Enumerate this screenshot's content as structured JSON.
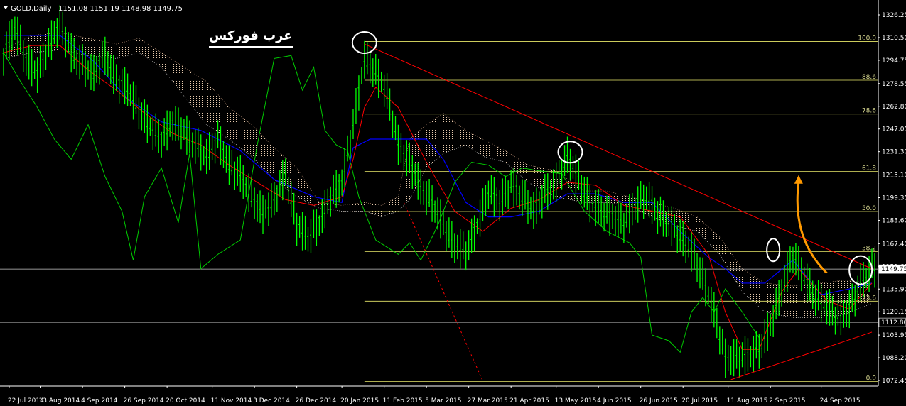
{
  "header": {
    "menu_glyph": "▼",
    "symbol": "GOLD,Daily",
    "ohlc": "1151.08 1151.19 1148.98 1149.75"
  },
  "logo_text": "عرب فوركس",
  "colors": {
    "background": "#000000",
    "price": "#00ff00",
    "kijun": "#0000ff",
    "tenkan": "#ff0000",
    "chikou": "#00cc00",
    "cloud_bull": "#ffe0c0",
    "cloud_bear": "#ffffff",
    "fib": "#e8e86a",
    "trend": "#ff0000",
    "arrow": "#ff9900",
    "circle": "#ffffff",
    "hline": "#c8c8c8"
  },
  "chart_data": {
    "type": "line",
    "symbol": "GOLD",
    "timeframe": "Daily",
    "y_ticks": [
      "1326.25",
      "1310.50",
      "1294.75",
      "1278.55",
      "1262.80",
      "1247.05",
      "1231.30",
      "1215.10",
      "1199.35",
      "1183.60",
      "1167.40",
      "1151.65",
      "1135.90",
      "1120.15",
      "1103.95",
      "1088.20",
      "1072.45"
    ],
    "x_ticks": [
      "22 Jul 2014",
      "13 Aug 2014",
      "4 Sep 2014",
      "26 Sep 2014",
      "20 Oct 2014",
      "11 Nov 2014",
      "3 Dec 2014",
      "26 Dec 2014",
      "20 Jan 2015",
      "11 Feb 2015",
      "5 Mar 2015",
      "27 Mar 2015",
      "21 Apr 2015",
      "13 May 2015",
      "4 Jun 2015",
      "26 Jun 2015",
      "20 Jul 2015",
      "11 Aug 2015",
      "2 Sep 2015",
      "24 Sep 2015"
    ],
    "ylim": [
      1072.45,
      1326.25
    ],
    "current_price_label": "1149.75",
    "horizontal_line_label": "1112.80",
    "current_price": 1149.75,
    "horizontal_line": 1112.8,
    "fibonacci": {
      "levels": [
        {
          "label": "100.0",
          "price": 1307.8
        },
        {
          "label": "88.6",
          "price": 1280.9
        },
        {
          "label": "78.6",
          "price": 1257.4
        },
        {
          "label": "61.8",
          "price": 1217.6
        },
        {
          "label": "50.0",
          "price": 1189.7
        },
        {
          "label": "38.2",
          "price": 1161.9
        },
        {
          "label": "23.6",
          "price": 1127.5
        },
        {
          "label": "0.0",
          "price": 1071.7
        }
      ],
      "start_date_index": 128
    },
    "price_series": [
      [
        0,
        1298
      ],
      [
        4,
        1318
      ],
      [
        8,
        1294
      ],
      [
        12,
        1286
      ],
      [
        16,
        1305
      ],
      [
        20,
        1320
      ],
      [
        24,
        1300
      ],
      [
        28,
        1292
      ],
      [
        32,
        1285
      ],
      [
        36,
        1298
      ],
      [
        40,
        1280
      ],
      [
        44,
        1275
      ],
      [
        48,
        1260
      ],
      [
        52,
        1248
      ],
      [
        56,
        1240
      ],
      [
        60,
        1252
      ],
      [
        64,
        1245
      ],
      [
        68,
        1236
      ],
      [
        72,
        1228
      ],
      [
        76,
        1240
      ],
      [
        80,
        1222
      ],
      [
        84,
        1215
      ],
      [
        88,
        1200
      ],
      [
        92,
        1188
      ],
      [
        96,
        1198
      ],
      [
        100,
        1216
      ],
      [
        104,
        1180
      ],
      [
        108,
        1172
      ],
      [
        112,
        1182
      ],
      [
        116,
        1200
      ],
      [
        120,
        1210
      ],
      [
        124,
        1250
      ],
      [
        128,
        1296
      ],
      [
        132,
        1286
      ],
      [
        136,
        1272
      ],
      [
        140,
        1236
      ],
      [
        144,
        1224
      ],
      [
        148,
        1206
      ],
      [
        152,
        1196
      ],
      [
        156,
        1180
      ],
      [
        160,
        1166
      ],
      [
        164,
        1162
      ],
      [
        168,
        1180
      ],
      [
        172,
        1204
      ],
      [
        176,
        1196
      ],
      [
        180,
        1208
      ],
      [
        184,
        1200
      ],
      [
        188,
        1190
      ],
      [
        192,
        1202
      ],
      [
        196,
        1210
      ],
      [
        200,
        1228
      ],
      [
        204,
        1212
      ],
      [
        208,
        1196
      ],
      [
        212,
        1190
      ],
      [
        216,
        1186
      ],
      [
        220,
        1182
      ],
      [
        224,
        1194
      ],
      [
        228,
        1200
      ],
      [
        232,
        1188
      ],
      [
        236,
        1182
      ],
      [
        240,
        1172
      ],
      [
        244,
        1162
      ],
      [
        248,
        1144
      ],
      [
        252,
        1120
      ],
      [
        256,
        1088
      ],
      [
        260,
        1088
      ],
      [
        264,
        1090
      ],
      [
        268,
        1094
      ],
      [
        272,
        1110
      ],
      [
        276,
        1136
      ],
      [
        280,
        1160
      ],
      [
        284,
        1144
      ],
      [
        288,
        1130
      ],
      [
        292,
        1124
      ],
      [
        296,
        1116
      ],
      [
        300,
        1122
      ],
      [
        304,
        1140
      ],
      [
        308,
        1150
      ]
    ],
    "tenkan_series": [
      [
        0,
        1300
      ],
      [
        10,
        1305
      ],
      [
        20,
        1305
      ],
      [
        30,
        1288
      ],
      [
        40,
        1274
      ],
      [
        50,
        1258
      ],
      [
        60,
        1244
      ],
      [
        70,
        1236
      ],
      [
        80,
        1222
      ],
      [
        90,
        1210
      ],
      [
        100,
        1198
      ],
      [
        110,
        1194
      ],
      [
        120,
        1200
      ],
      [
        124,
        1226
      ],
      [
        128,
        1262
      ],
      [
        132,
        1276
      ],
      [
        140,
        1262
      ],
      [
        150,
        1224
      ],
      [
        160,
        1190
      ],
      [
        170,
        1176
      ],
      [
        180,
        1192
      ],
      [
        190,
        1198
      ],
      [
        200,
        1210
      ],
      [
        210,
        1208
      ],
      [
        220,
        1194
      ],
      [
        230,
        1190
      ],
      [
        240,
        1186
      ],
      [
        250,
        1160
      ],
      [
        256,
        1120
      ],
      [
        262,
        1094
      ],
      [
        268,
        1094
      ],
      [
        276,
        1134
      ],
      [
        282,
        1150
      ],
      [
        292,
        1128
      ],
      [
        300,
        1122
      ],
      [
        308,
        1140
      ]
    ],
    "kijun_series": [
      [
        0,
        1312
      ],
      [
        20,
        1312
      ],
      [
        32,
        1294
      ],
      [
        44,
        1268
      ],
      [
        56,
        1252
      ],
      [
        70,
        1246
      ],
      [
        84,
        1232
      ],
      [
        96,
        1212
      ],
      [
        110,
        1200
      ],
      [
        120,
        1196
      ],
      [
        124,
        1234
      ],
      [
        130,
        1240
      ],
      [
        140,
        1240
      ],
      [
        150,
        1240
      ],
      [
        156,
        1226
      ],
      [
        164,
        1196
      ],
      [
        172,
        1186
      ],
      [
        180,
        1186
      ],
      [
        190,
        1190
      ],
      [
        200,
        1202
      ],
      [
        210,
        1202
      ],
      [
        220,
        1196
      ],
      [
        230,
        1196
      ],
      [
        240,
        1176
      ],
      [
        250,
        1158
      ],
      [
        256,
        1150
      ],
      [
        262,
        1140
      ],
      [
        270,
        1140
      ],
      [
        280,
        1156
      ],
      [
        290,
        1132
      ],
      [
        300,
        1136
      ],
      [
        308,
        1140
      ]
    ],
    "chikou_series": [
      [
        0,
        1300
      ],
      [
        6,
        1280
      ],
      [
        12,
        1262
      ],
      [
        18,
        1240
      ],
      [
        24,
        1226
      ],
      [
        30,
        1250
      ],
      [
        36,
        1214
      ],
      [
        42,
        1190
      ],
      [
        46,
        1156
      ],
      [
        50,
        1200
      ],
      [
        56,
        1220
      ],
      [
        62,
        1182
      ],
      [
        66,
        1230
      ],
      [
        70,
        1150
      ],
      [
        76,
        1160
      ],
      [
        84,
        1170
      ],
      [
        90,
        1236
      ],
      [
        96,
        1296
      ],
      [
        102,
        1298
      ],
      [
        106,
        1274
      ],
      [
        110,
        1290
      ],
      [
        114,
        1246
      ],
      [
        118,
        1236
      ],
      [
        122,
        1232
      ],
      [
        126,
        1200
      ],
      [
        132,
        1170
      ],
      [
        136,
        1165
      ],
      [
        140,
        1160
      ],
      [
        144,
        1168
      ],
      [
        148,
        1156
      ],
      [
        154,
        1180
      ],
      [
        160,
        1210
      ],
      [
        166,
        1224
      ],
      [
        172,
        1222
      ],
      [
        178,
        1214
      ],
      [
        184,
        1220
      ],
      [
        190,
        1218
      ],
      [
        198,
        1216
      ],
      [
        206,
        1190
      ],
      [
        214,
        1176
      ],
      [
        222,
        1168
      ],
      [
        226,
        1158
      ],
      [
        230,
        1104
      ],
      [
        236,
        1100
      ],
      [
        240,
        1092
      ],
      [
        244,
        1120
      ],
      [
        248,
        1130
      ],
      [
        252,
        1120
      ],
      [
        256,
        1136
      ],
      [
        262,
        1120
      ],
      [
        268,
        1102
      ]
    ],
    "cloud": [
      [
        0,
        1296,
        1302
      ],
      [
        10,
        1300,
        1312
      ],
      [
        20,
        1302,
        1314
      ],
      [
        30,
        1298,
        1310
      ],
      [
        40,
        1296,
        1306
      ],
      [
        48,
        1300,
        1310
      ],
      [
        56,
        1290,
        1300
      ],
      [
        64,
        1270,
        1290
      ],
      [
        72,
        1250,
        1280
      ],
      [
        80,
        1240,
        1262
      ],
      [
        88,
        1228,
        1250
      ],
      [
        96,
        1212,
        1234
      ],
      [
        104,
        1200,
        1220
      ],
      [
        112,
        1192,
        1196
      ],
      [
        120,
        1190,
        1194
      ],
      [
        128,
        1190,
        1196
      ],
      [
        134,
        1186,
        1194
      ],
      [
        140,
        1190,
        1200
      ],
      [
        144,
        1198,
        1240
      ],
      [
        150,
        1220,
        1250
      ],
      [
        156,
        1230,
        1258
      ],
      [
        164,
        1236,
        1246
      ],
      [
        170,
        1228,
        1240
      ],
      [
        178,
        1224,
        1232
      ],
      [
        186,
        1210,
        1222
      ],
      [
        196,
        1200,
        1218
      ],
      [
        206,
        1196,
        1204
      ],
      [
        214,
        1196,
        1204
      ],
      [
        222,
        1194,
        1200
      ],
      [
        230,
        1186,
        1196
      ],
      [
        238,
        1180,
        1192
      ],
      [
        246,
        1176,
        1186
      ],
      [
        254,
        1160,
        1172
      ],
      [
        262,
        1134,
        1150
      ],
      [
        270,
        1120,
        1140
      ],
      [
        280,
        1116,
        1138
      ],
      [
        290,
        1116,
        1140
      ],
      [
        298,
        1118,
        1142
      ],
      [
        308,
        1126,
        1140
      ]
    ],
    "trendlines": [
      {
        "from": [
          128,
          1306
        ],
        "to": [
          308,
          1150
        ],
        "style": "solid"
      },
      {
        "from": [
          258,
          1073
        ],
        "to": [
          308,
          1106
        ],
        "style": "solid"
      },
      {
        "from": [
          142,
          1196
        ],
        "to": [
          170,
          1072
        ],
        "style": "dashed"
      }
    ],
    "circles": [
      [
        128,
        1307
      ],
      [
        201,
        1231
      ],
      [
        273,
        1163
      ],
      [
        304,
        1149
      ]
    ],
    "arrow": {
      "from": [
        292,
        1147
      ],
      "to": [
        282,
        1215
      ]
    }
  }
}
